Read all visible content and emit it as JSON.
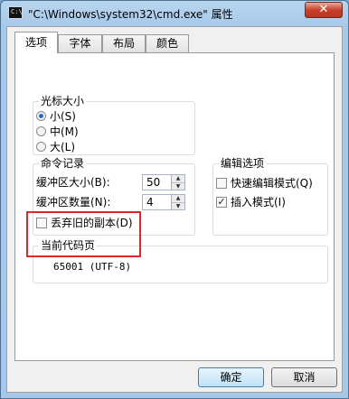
{
  "window": {
    "title": "\"C:\\Windows\\system32\\cmd.exe\" 属性",
    "icon_text": "C:\\"
  },
  "tabs": [
    {
      "label": "选项",
      "active": true
    },
    {
      "label": "字体",
      "active": false
    },
    {
      "label": "布局",
      "active": false
    },
    {
      "label": "颜色",
      "active": false
    }
  ],
  "cursor_size": {
    "title": "光标大小",
    "options": [
      {
        "label": "小(S)",
        "selected": true
      },
      {
        "label": "中(M)",
        "selected": false
      },
      {
        "label": "大(L)",
        "selected": false
      }
    ]
  },
  "command_history": {
    "title": "命令记录",
    "buffer_size_label": "缓冲区大小(B):",
    "buffer_size_value": "50",
    "buffer_count_label": "缓冲区数量(N):",
    "buffer_count_value": "4",
    "discard_dup_label": "丢弃旧的副本(D)",
    "discard_dup_checked": false
  },
  "edit_options": {
    "title": "编辑选项",
    "quick_edit_label": "快速编辑模式(Q)",
    "quick_edit_checked": false,
    "insert_mode_label": "插入模式(I)",
    "insert_mode_checked": true
  },
  "code_page": {
    "title": "当前代码页",
    "value": "65001  (UTF-8)"
  },
  "buttons": {
    "ok": "确定",
    "cancel": "取消"
  },
  "colors": {
    "highlight_border": "#e0282b",
    "radio_dot": "#2c6bc4"
  }
}
